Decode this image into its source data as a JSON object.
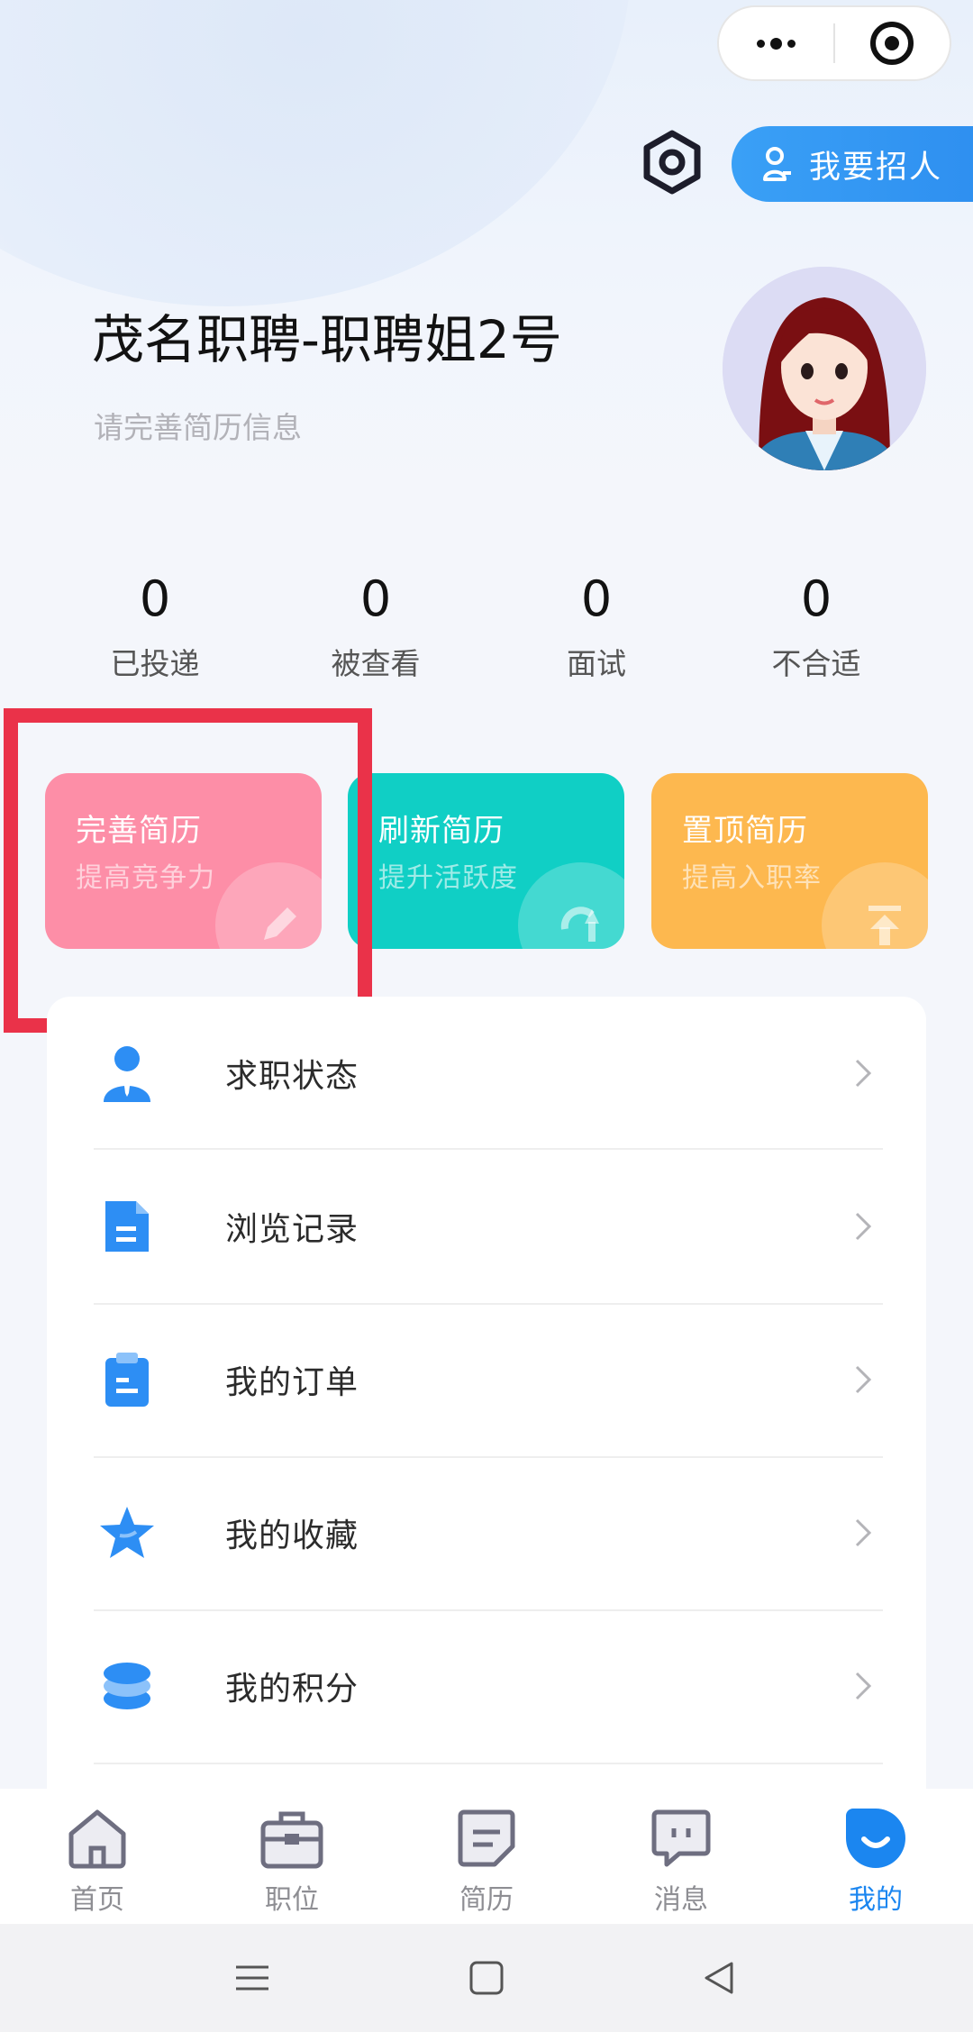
{
  "header": {
    "recruit_label": "我要招人"
  },
  "profile": {
    "name": "茂名职聘-职聘姐2号",
    "subtitle": "请完善简历信息"
  },
  "stats": [
    {
      "value": "0",
      "label": "已投递"
    },
    {
      "value": "0",
      "label": "被查看"
    },
    {
      "value": "0",
      "label": "面试"
    },
    {
      "value": "0",
      "label": "不合适"
    }
  ],
  "cards": [
    {
      "title": "完善简历",
      "subtitle": "提高竞争力",
      "color": "#fd8ea7"
    },
    {
      "title": "刷新简历",
      "subtitle": "提升活跃度",
      "color": "#10cfc5"
    },
    {
      "title": "置顶简历",
      "subtitle": "提高入职率",
      "color": "#fdb84f"
    }
  ],
  "menu": [
    {
      "label": "求职状态",
      "icon": "job-status-icon"
    },
    {
      "label": "浏览记录",
      "icon": "document-icon"
    },
    {
      "label": "我的订单",
      "icon": "clipboard-icon"
    },
    {
      "label": "我的收藏",
      "icon": "star-icon"
    },
    {
      "label": "我的积分",
      "icon": "coins-icon"
    }
  ],
  "tabs": [
    {
      "label": "首页",
      "icon": "home-icon"
    },
    {
      "label": "职位",
      "icon": "briefcase-icon"
    },
    {
      "label": "简历",
      "icon": "resume-icon"
    },
    {
      "label": "消息",
      "icon": "message-icon"
    },
    {
      "label": "我的",
      "icon": "profile-icon",
      "active": true
    }
  ],
  "colors": {
    "accent": "#1b86f0",
    "highlight": "#ea3249"
  }
}
